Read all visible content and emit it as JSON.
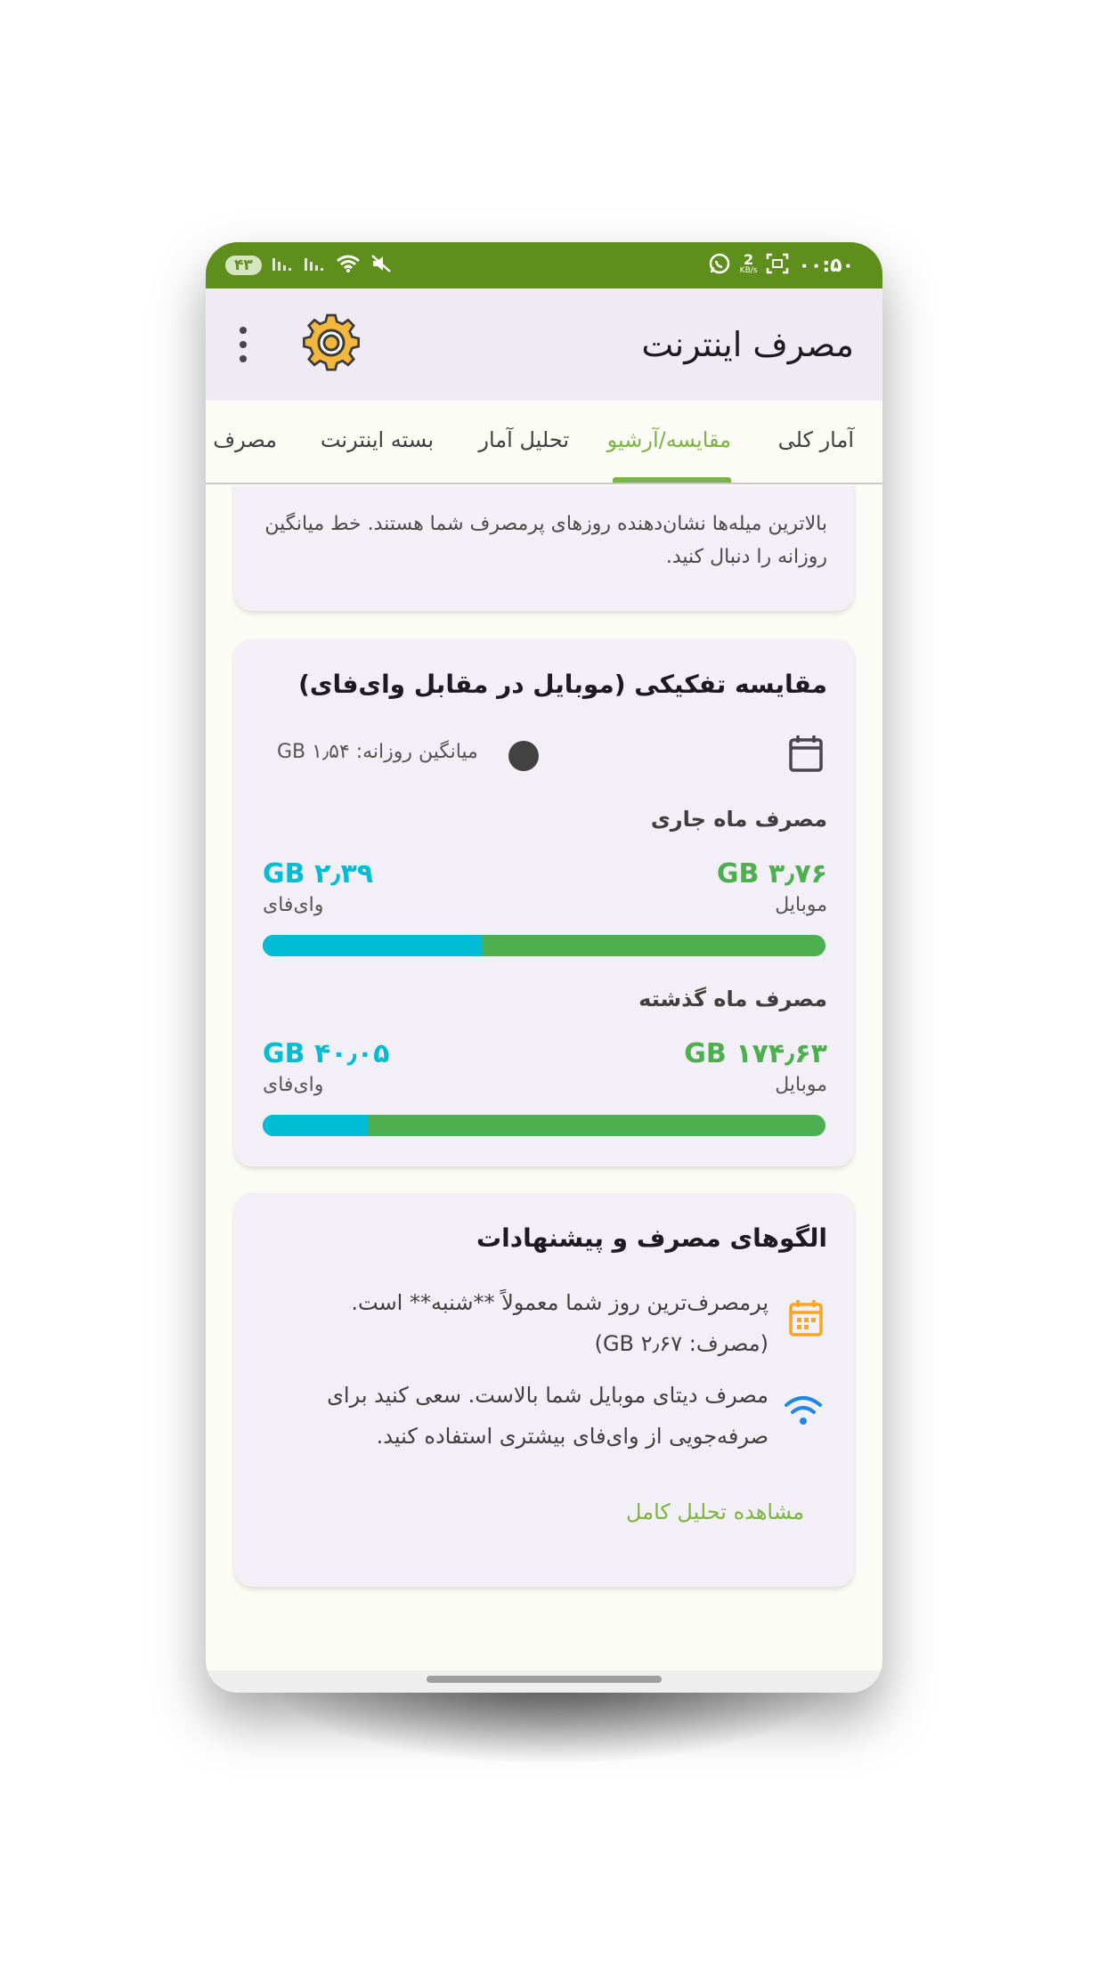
{
  "status_bar": {
    "time": "۰۰:۵۰",
    "net_speed": "2",
    "net_unit": "KB/s",
    "battery": "۴۳"
  },
  "app_bar": {
    "title": "مصرف اینترنت"
  },
  "tabs": [
    {
      "label": "آمار کلی",
      "active": false
    },
    {
      "label": "مقایسه/آرشیو",
      "active": true
    },
    {
      "label": "تحلیل آمار",
      "active": false
    },
    {
      "label": "بسته اینترنت",
      "active": false
    },
    {
      "label": "مصرف ب",
      "active": false
    }
  ],
  "chart_note": {
    "text": "بالاترین میله‌ها نشان‌دهنده روزهای پرمصرف شما هستند. خط میانگین روزانه را دنبال کنید."
  },
  "comparison": {
    "title": "مقایسه تفکیکی (موبایل در مقابل وای‌فای)",
    "daily_avg": "میانگین روزانه: ۱٫۵۴ GB",
    "current_month": {
      "title": "مصرف ماه جاری",
      "mobile_value": "۳٫۷۶ GB",
      "mobile_label": "موبایل",
      "wifi_value": "۲٫۳۹ GB",
      "wifi_label": "وای‌فای",
      "wifi_fraction": 0.389
    },
    "last_month": {
      "title": "مصرف ماه گذشته",
      "mobile_value": "۱۷۴٫۶۳ GB",
      "mobile_label": "موبایل",
      "wifi_value": "۴۰٫۰۵ GB",
      "wifi_label": "وای‌فای",
      "wifi_fraction": 0.187
    },
    "colors": {
      "mobile": "#4caf50",
      "wifi": "#00bcd4"
    }
  },
  "patterns": {
    "title": "الگوهای مصرف و پیشنهادات",
    "items": [
      {
        "icon": "calendar-icon",
        "text": "پرمصرف‌ترین روز شما معمولاً **شنبه** است. (مصرف: ۲٫۶۷ GB)"
      },
      {
        "icon": "wifi-icon",
        "text": "مصرف دیتای موبایل شما بالاست. سعی کنید برای صرفه‌جویی از وای‌فای بیشتری استفاده کنید."
      }
    ],
    "link": "مشاهده تحلیل کامل"
  }
}
